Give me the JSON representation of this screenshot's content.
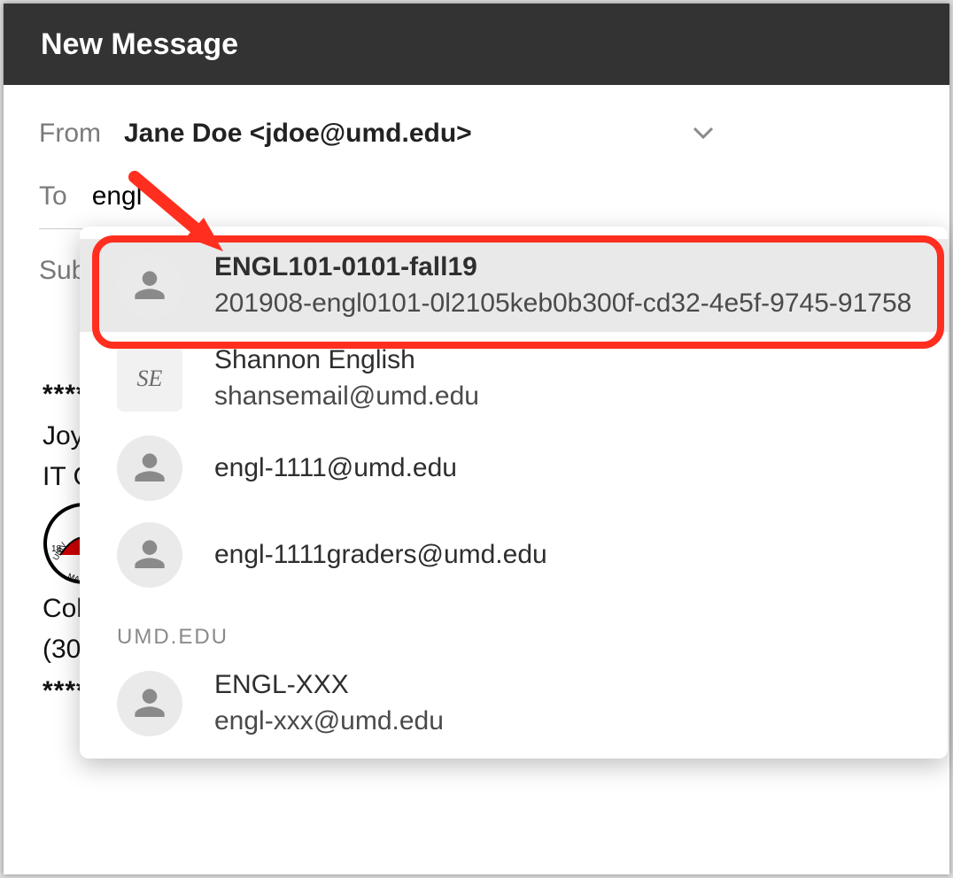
{
  "header": {
    "title": "New Message"
  },
  "fields": {
    "from_label": "From",
    "from_value": "Jane Doe <jdoe@umd.edu>",
    "to_label": "To",
    "to_value": "engl",
    "subject_label": "Sub"
  },
  "body_preview": {
    "line1": "****",
    "line2": "Joy",
    "line3": "IT C",
    "line4": "Col",
    "line5": "(30",
    "line6": "****"
  },
  "autocomplete": {
    "items": [
      {
        "primary": "ENGL101-0101-fall19",
        "secondary": "201908-engl0101-0l2105keb0b300f-cd32-4e5f-9745-91758",
        "avatar": "person",
        "highlight": true,
        "bold_primary": true
      },
      {
        "primary": "Shannon English",
        "secondary": "shansemail@umd.edu",
        "avatar": "initials",
        "initials": "SE"
      },
      {
        "primary": "engl-1111@umd.edu",
        "avatar": "person"
      },
      {
        "primary": "engl-1111graders@umd.edu",
        "avatar": "person"
      }
    ],
    "section_label": "UMD.EDU",
    "section_items": [
      {
        "primary": "ENGL-XXX",
        "secondary": "engl-xxx@umd.edu",
        "avatar": "person"
      }
    ]
  },
  "annotation": {
    "circle_target_index": 0
  }
}
